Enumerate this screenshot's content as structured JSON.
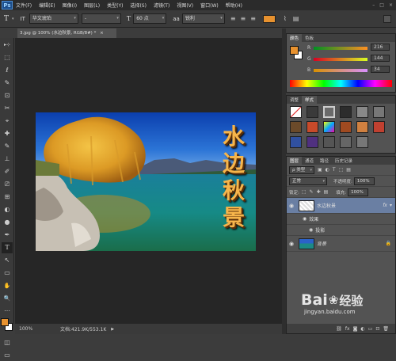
{
  "menubar": {
    "logo": "Ps",
    "items": [
      "文件(F)",
      "编辑(E)",
      "图像(I)",
      "图层(L)",
      "类型(Y)",
      "选择(S)",
      "滤镜(T)",
      "视图(V)",
      "窗口(W)",
      "帮助(H)"
    ]
  },
  "options": {
    "tool_glyph": "T",
    "orient_glyph": "IT",
    "font_family": "华文琥珀",
    "font_style": "-",
    "size_glyph": "T",
    "font_size": "60 点",
    "aa_glyph": "aa",
    "antialias": "锐利",
    "text_color": "#e8922f"
  },
  "document": {
    "tab_title": "3.jpg @ 100% (水边秋景, RGB/8#) *",
    "close_glyph": "×",
    "title_chars": [
      "水",
      "边",
      "秋",
      "景"
    ]
  },
  "status": {
    "zoom": "100%",
    "doc_info": "文档:421.9K/553.1K",
    "arrow": "▶"
  },
  "toolbar": {
    "tools": [
      "▸⊹",
      "⬚",
      "ℓ",
      "✎",
      "⊡",
      "✂",
      "⌖",
      "✚",
      "✎",
      "⊥",
      "✐",
      "⎚",
      "⊞",
      "◐",
      "●",
      "✒",
      "T",
      "↖",
      "▭",
      "✋",
      "🔍",
      "⋯"
    ],
    "fg_color": "#e8922f",
    "bg_color": "#ffffff"
  },
  "color_panel": {
    "tabs": [
      "颜色",
      "色板"
    ],
    "channels": [
      {
        "name": "R",
        "value": "216"
      },
      {
        "name": "G",
        "value": "144"
      },
      {
        "name": "B",
        "value": "34"
      }
    ]
  },
  "styles_panel": {
    "tabs": [
      "调整",
      "样式"
    ]
  },
  "layers_panel": {
    "tabs": [
      "图层",
      "通道",
      "路径",
      "历史记录"
    ],
    "filter_label": "ρ 类型",
    "blend_mode": "正常",
    "opacity_label": "不透明度:",
    "opacity": "100%",
    "lock_label": "锁定:",
    "fill_label": "填充:",
    "fill": "100%",
    "layers": [
      {
        "name": "水边秋景",
        "fx": "fx",
        "type": "text"
      },
      {
        "name": "效果",
        "type": "effects"
      },
      {
        "name": "投影",
        "type": "effect"
      },
      {
        "name": "背景",
        "type": "bg"
      }
    ]
  },
  "watermark": {
    "brand": "Bai",
    "brand2": "经验",
    "url": "jingyan.baidu.com"
  }
}
